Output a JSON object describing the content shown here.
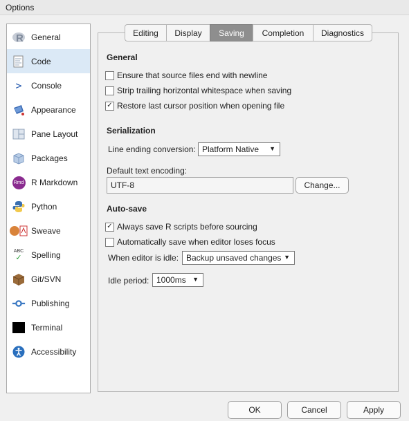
{
  "window": {
    "title": "Options"
  },
  "sidebar": {
    "items": [
      {
        "label": "General",
        "icon": "r-logo-icon",
        "selected": false
      },
      {
        "label": "Code",
        "icon": "code-file-icon",
        "selected": true
      },
      {
        "label": "Console",
        "icon": "console-prompt-icon",
        "selected": false
      },
      {
        "label": "Appearance",
        "icon": "paint-bucket-icon",
        "selected": false
      },
      {
        "label": "Pane Layout",
        "icon": "pane-layout-icon",
        "selected": false
      },
      {
        "label": "Packages",
        "icon": "package-box-icon",
        "selected": false
      },
      {
        "label": "R Markdown",
        "icon": "rmd-icon",
        "selected": false
      },
      {
        "label": "Python",
        "icon": "python-logo-icon",
        "selected": false
      },
      {
        "label": "Sweave",
        "icon": "sweave-pdf-icon",
        "selected": false
      },
      {
        "label": "Spelling",
        "icon": "spelling-abc-icon",
        "selected": false
      },
      {
        "label": "Git/SVN",
        "icon": "git-box-icon",
        "selected": false
      },
      {
        "label": "Publishing",
        "icon": "publishing-icon",
        "selected": false
      },
      {
        "label": "Terminal",
        "icon": "terminal-icon",
        "selected": false
      },
      {
        "label": "Accessibility",
        "icon": "accessibility-icon",
        "selected": false
      }
    ]
  },
  "tabs": [
    {
      "label": "Editing",
      "active": false
    },
    {
      "label": "Display",
      "active": false
    },
    {
      "label": "Saving",
      "active": true
    },
    {
      "label": "Completion",
      "active": false
    },
    {
      "label": "Diagnostics",
      "active": false
    }
  ],
  "general": {
    "heading": "General",
    "options": [
      {
        "label": "Ensure that source files end with newline",
        "checked": false
      },
      {
        "label": "Strip trailing horizontal whitespace when saving",
        "checked": false
      },
      {
        "label": "Restore last cursor position when opening file",
        "checked": true
      }
    ]
  },
  "serialization": {
    "heading": "Serialization",
    "line_ending_label": "Line ending conversion:",
    "line_ending_value": "Platform Native",
    "encoding_label": "Default text encoding:",
    "encoding_value": "UTF-8",
    "change_button": "Change..."
  },
  "autosave": {
    "heading": "Auto-save",
    "options": [
      {
        "label": "Always save R scripts before sourcing",
        "checked": true
      },
      {
        "label": "Automatically save when editor loses focus",
        "checked": false
      }
    ],
    "idle_label": "When editor is idle:",
    "idle_value": "Backup unsaved changes",
    "period_label": "Idle period:",
    "period_value": "1000ms"
  },
  "footer": {
    "ok": "OK",
    "cancel": "Cancel",
    "apply": "Apply"
  },
  "glyphs": {
    "check": "✓",
    "dropdown": "▼",
    "console": ">",
    "rmd": "Rmd",
    "spelling": "ABC"
  },
  "colors": {
    "selected_bg": "#dbe9f6",
    "active_tab": "#8e8e8e"
  }
}
